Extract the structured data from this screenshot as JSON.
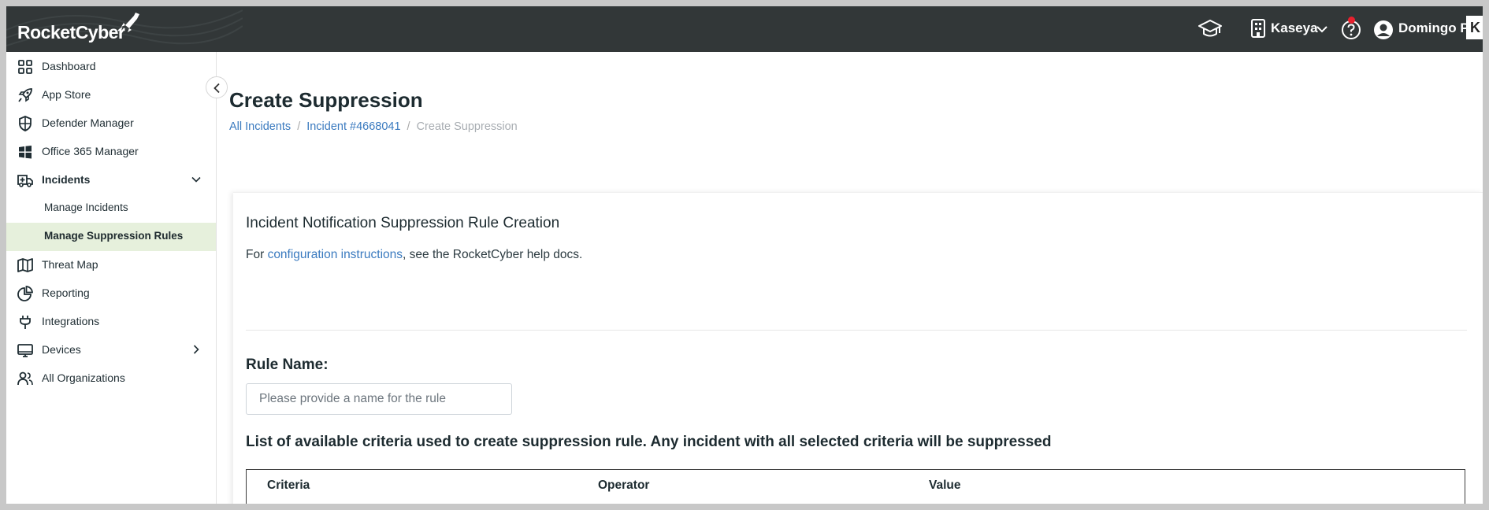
{
  "brand": {
    "name": "RocketCyber"
  },
  "topbar": {
    "org_name": "Kaseya",
    "user_name": "Domingo P.",
    "badge": "K",
    "icons": [
      "graduation-cap-icon",
      "building-icon",
      "help-circle-icon",
      "user-circle-icon"
    ]
  },
  "sidebar": {
    "items": [
      {
        "label": "Dashboard",
        "icon": "grid-icon"
      },
      {
        "label": "App Store",
        "icon": "rocket-icon"
      },
      {
        "label": "Defender Manager",
        "icon": "shield-icon"
      },
      {
        "label": "Office 365 Manager",
        "icon": "windows-icon"
      },
      {
        "label": "Incidents",
        "icon": "ambulance-icon",
        "expanded": true
      },
      {
        "label": "Manage Incidents"
      },
      {
        "label": "Manage Suppression Rules",
        "active": true
      },
      {
        "label": "Threat Map",
        "icon": "map-icon"
      },
      {
        "label": "Reporting",
        "icon": "pie-chart-icon"
      },
      {
        "label": "Integrations",
        "icon": "plug-icon"
      },
      {
        "label": "Devices",
        "icon": "monitor-icon"
      },
      {
        "label": "All Organizations",
        "icon": "users-icon"
      }
    ]
  },
  "page": {
    "title": "Create Suppression",
    "breadcrumb": [
      "All Incidents",
      "Incident #4668041",
      "Create Suppression"
    ]
  },
  "card": {
    "title": "Incident Notification Suppression Rule Creation",
    "desc_prefix": "For ",
    "desc_link": "configuration instructions",
    "desc_suffix": ", see the RocketCyber help docs.",
    "rule_name_label": "Rule Name:",
    "rule_name_placeholder": "Please provide a name for the rule",
    "criteria_heading": "List of available criteria used to create suppression rule. Any incident with all selected criteria will be suppressed",
    "table_headers": [
      "Criteria",
      "Operator",
      "Value"
    ]
  },
  "colors": {
    "topbar": "#323738",
    "link": "#3a7abf",
    "active_bg": "#e6f0dc",
    "notification": "#e8212e"
  }
}
